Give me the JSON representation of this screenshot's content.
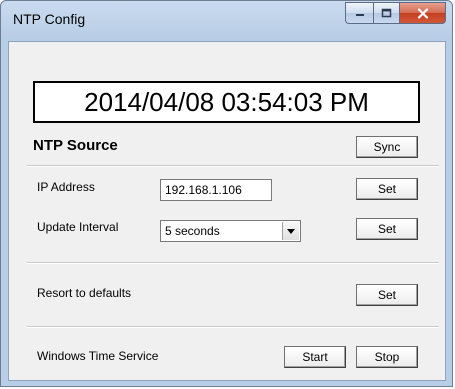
{
  "window": {
    "title": "NTP Config"
  },
  "clock": {
    "datetime": "2014/04/08 03:54:03 PM"
  },
  "ntp_source": {
    "heading": "NTP Source",
    "sync_label": "Sync",
    "ip_label": "IP Address",
    "ip_value": "192.168.1.106",
    "ip_set_label": "Set",
    "interval_label": "Update Interval",
    "interval_value": "5 seconds",
    "interval_set_label": "Set"
  },
  "defaults": {
    "label": "Resort to defaults",
    "set_label": "Set"
  },
  "time_service": {
    "label": "Windows Time Service",
    "start_label": "Start",
    "stop_label": "Stop"
  },
  "icons": {
    "minimize": "minimize-icon",
    "maximize": "maximize-icon",
    "close": "close-icon",
    "dropdown": "chevron-down-icon"
  }
}
